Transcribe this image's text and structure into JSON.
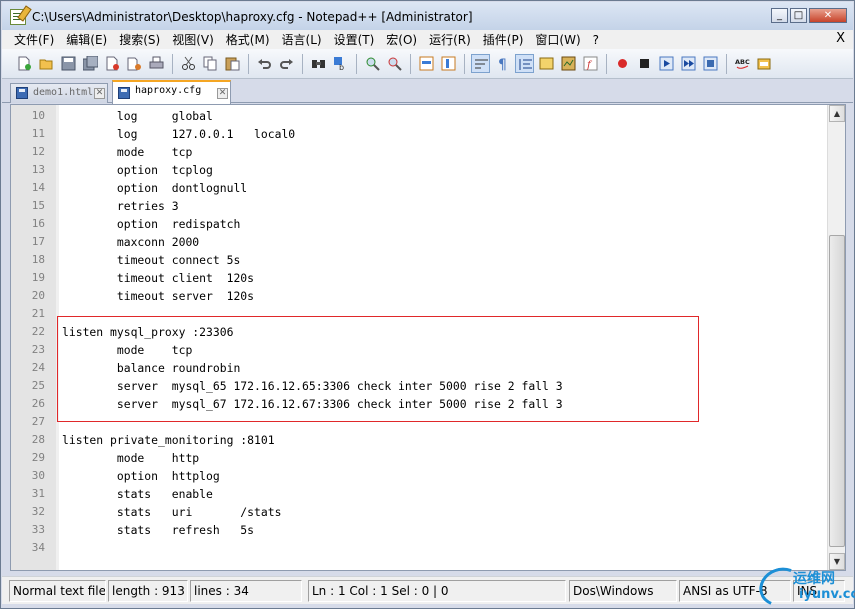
{
  "window": {
    "title": "C:\\Users\\Administrator\\Desktop\\haproxy.cfg - Notepad++ [Administrator]",
    "minimize": "_",
    "maximize": "□",
    "close": "✕"
  },
  "menu": {
    "items": [
      "文件(F)",
      "编辑(E)",
      "搜索(S)",
      "视图(V)",
      "格式(M)",
      "语言(L)",
      "设置(T)",
      "宏(O)",
      "运行(R)",
      "插件(P)",
      "窗口(W)",
      "?"
    ],
    "close_doc": "X"
  },
  "toolbar": {
    "icons": [
      "new-file-icon",
      "open-file-icon",
      "save-icon",
      "save-all-icon",
      "close-icon",
      "close-all-icon",
      "print-icon",
      "cut-icon",
      "copy-icon",
      "paste-icon",
      "undo-icon",
      "redo-icon",
      "find-icon",
      "replace-icon",
      "zoom-in-icon",
      "zoom-out-icon",
      "sync-vertical-icon",
      "sync-horizontal-icon",
      "word-wrap-icon",
      "show-all-chars-icon",
      "indent-guide-icon",
      "user-lang-icon",
      "doc-map-icon",
      "function-list-icon",
      "record-macro-icon",
      "stop-record-icon",
      "play-macro-icon",
      "run-macro-multiple-icon",
      "save-macro-icon",
      "spell-check-icon",
      "spell-check-options-icon"
    ]
  },
  "tabs": [
    {
      "label": "demo1.html",
      "active": false,
      "close": "✕"
    },
    {
      "label": "haproxy.cfg",
      "active": true,
      "close": "✕"
    }
  ],
  "editor": {
    "lines": [
      {
        "n": "10",
        "text": "        log     global"
      },
      {
        "n": "11",
        "text": "        log     127.0.0.1   local0"
      },
      {
        "n": "12",
        "text": "        mode    tcp"
      },
      {
        "n": "13",
        "text": "        option  tcplog"
      },
      {
        "n": "14",
        "text": "        option  dontlognull"
      },
      {
        "n": "15",
        "text": "        retries 3"
      },
      {
        "n": "16",
        "text": "        option  redispatch"
      },
      {
        "n": "17",
        "text": "        maxconn 2000"
      },
      {
        "n": "18",
        "text": "        timeout connect 5s"
      },
      {
        "n": "19",
        "text": "        timeout client  120s"
      },
      {
        "n": "20",
        "text": "        timeout server  120s"
      },
      {
        "n": "21",
        "text": ""
      },
      {
        "n": "22",
        "text": "listen mysql_proxy :23306"
      },
      {
        "n": "23",
        "text": "        mode    tcp"
      },
      {
        "n": "24",
        "text": "        balance roundrobin"
      },
      {
        "n": "25",
        "text": "        server  mysql_65 172.16.12.65:3306 check inter 5000 rise 2 fall 3"
      },
      {
        "n": "26",
        "text": "        server  mysql_67 172.16.12.67:3306 check inter 5000 rise 2 fall 3"
      },
      {
        "n": "27",
        "text": ""
      },
      {
        "n": "28",
        "text": "listen private_monitoring :8101"
      },
      {
        "n": "29",
        "text": "        mode    http"
      },
      {
        "n": "30",
        "text": "        option  httplog"
      },
      {
        "n": "31",
        "text": "        stats   enable"
      },
      {
        "n": "32",
        "text": "        stats   uri       /stats"
      },
      {
        "n": "33",
        "text": "        stats   refresh   5s"
      },
      {
        "n": "34",
        "text": ""
      }
    ],
    "scroll_up": "▲",
    "scroll_down": "▼"
  },
  "status": {
    "file_type": "Normal text file",
    "length": "length : 913",
    "lines": "lines : 34",
    "position": "Ln : 1    Col : 1    Sel : 0 | 0",
    "eol": "Dos\\Windows",
    "encoding": "ANSI as UTF-8",
    "mode": "INS"
  },
  "watermark": {
    "cn": "运维网",
    "en": "iyunv.com"
  }
}
